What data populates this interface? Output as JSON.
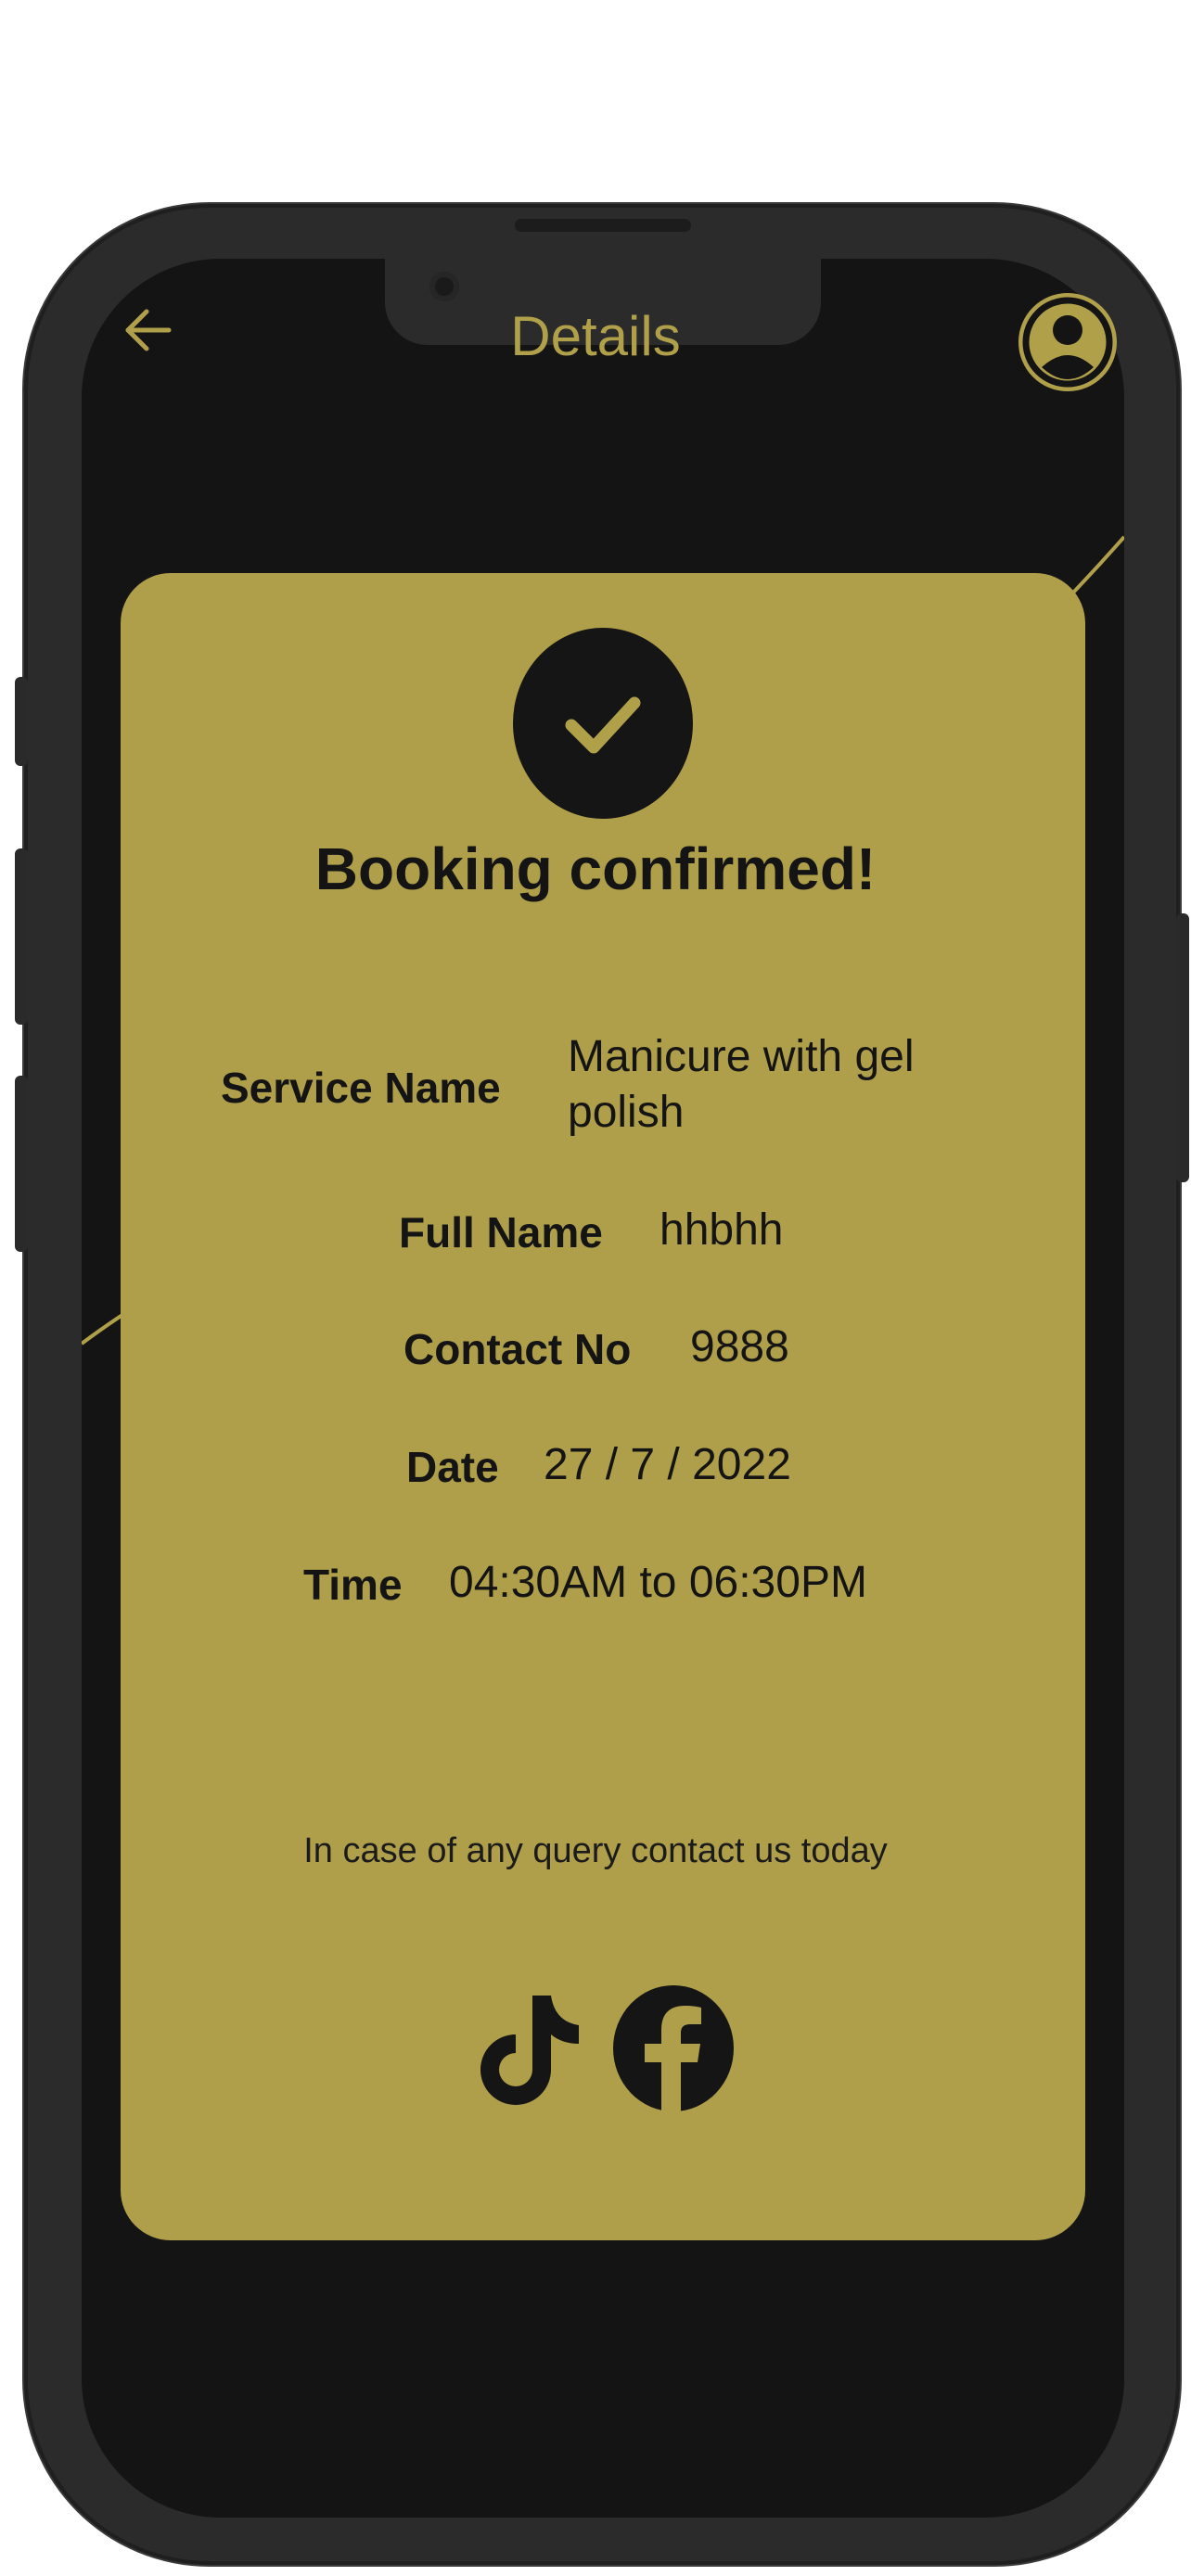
{
  "header": {
    "title": "Details",
    "back_icon": "arrow-left-icon",
    "profile_icon": "user-avatar-icon"
  },
  "confirmation": {
    "icon": "check-icon",
    "title": "Booking confirmed!"
  },
  "details": {
    "service_label": "Service Name",
    "service_value_line1": "Manicure with gel",
    "service_value_line2": "polish",
    "full_name_label": "Full Name",
    "full_name_value": "hhbhh",
    "contact_label": "Contact No",
    "contact_value": "9888",
    "date_label": "Date",
    "date_value": "27 / 7 / 2022",
    "time_label": "Time",
    "time_value": "04:30AM to 06:30PM"
  },
  "footer": {
    "query_text": "In case of any query contact us today",
    "social_icons": [
      "tiktok-icon",
      "facebook-icon"
    ]
  },
  "colors": {
    "accent": "#b1a04a",
    "background": "#141414",
    "card": "#b09f4a",
    "text_dark": "#141414"
  }
}
